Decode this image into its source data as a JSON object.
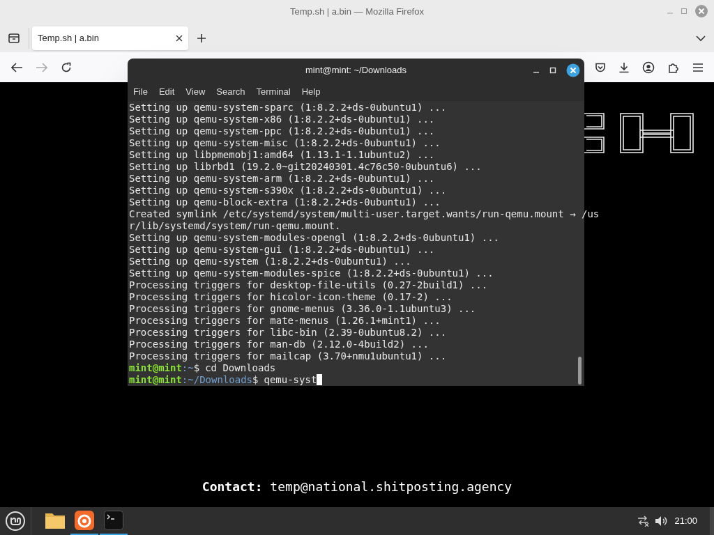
{
  "window": {
    "title": "Temp.sh | a.bin — Mozilla Firefox"
  },
  "tabs": [
    {
      "label": "Temp.sh | a.bin",
      "selected": true
    }
  ],
  "page": {
    "contact": "**Contact:** temp@national.shitposting.agency"
  },
  "terminal": {
    "title": "mint@mint: ~/Downloads",
    "menu": [
      "File",
      "Edit",
      "View",
      "Search",
      "Terminal",
      "Help"
    ],
    "lines": [
      {
        "kind": "output",
        "text": "Setting up qemu-system-sparc (1:8.2.2+ds-0ubuntu1) ..."
      },
      {
        "kind": "output",
        "text": "Setting up qemu-system-x86 (1:8.2.2+ds-0ubuntu1) ..."
      },
      {
        "kind": "output",
        "text": "Setting up qemu-system-ppc (1:8.2.2+ds-0ubuntu1) ..."
      },
      {
        "kind": "output",
        "text": "Setting up qemu-system-misc (1:8.2.2+ds-0ubuntu1) ..."
      },
      {
        "kind": "output",
        "text": "Setting up libpmemobj1:amd64 (1.13.1-1.1ubuntu2) ..."
      },
      {
        "kind": "output",
        "text": "Setting up librbd1 (19.2.0~git20240301.4c76c50-0ubuntu6) ..."
      },
      {
        "kind": "output",
        "text": "Setting up qemu-system-arm (1:8.2.2+ds-0ubuntu1) ..."
      },
      {
        "kind": "output",
        "text": "Setting up qemu-system-s390x (1:8.2.2+ds-0ubuntu1) ..."
      },
      {
        "kind": "output",
        "text": "Setting up qemu-block-extra (1:8.2.2+ds-0ubuntu1) ..."
      },
      {
        "kind": "output",
        "text": "Created symlink /etc/systemd/system/multi-user.target.wants/run-qemu.mount → /us"
      },
      {
        "kind": "output",
        "text": "r/lib/systemd/system/run-qemu.mount."
      },
      {
        "kind": "output",
        "text": "Setting up qemu-system-modules-opengl (1:8.2.2+ds-0ubuntu1) ..."
      },
      {
        "kind": "output",
        "text": "Setting up qemu-system-gui (1:8.2.2+ds-0ubuntu1) ..."
      },
      {
        "kind": "output",
        "text": "Setting up qemu-system (1:8.2.2+ds-0ubuntu1) ..."
      },
      {
        "kind": "output",
        "text": "Setting up qemu-system-modules-spice (1:8.2.2+ds-0ubuntu1) ..."
      },
      {
        "kind": "output",
        "text": "Processing triggers for desktop-file-utils (0.27-2build1) ..."
      },
      {
        "kind": "output",
        "text": "Processing triggers for hicolor-icon-theme (0.17-2) ..."
      },
      {
        "kind": "output",
        "text": "Processing triggers for gnome-menus (3.36.0-1.1ubuntu3) ..."
      },
      {
        "kind": "output",
        "text": "Processing triggers for mate-menus (1.26.1+mint1) ..."
      },
      {
        "kind": "output",
        "text": "Processing triggers for libc-bin (2.39-0ubuntu8.2) ..."
      },
      {
        "kind": "output",
        "text": "Processing triggers for man-db (2.12.0-4build2) ..."
      },
      {
        "kind": "output",
        "text": "Processing triggers for mailcap (3.70+nmu1ubuntu1) ..."
      },
      {
        "kind": "prompt",
        "user": "mint@mint",
        "path": ":~",
        "symbol": "$",
        "command": "cd Downloads",
        "cursor": false
      },
      {
        "kind": "prompt",
        "user": "mint@mint",
        "path": ":~/Downloads",
        "symbol": "$",
        "command": "qemu-syst",
        "cursor": true
      }
    ]
  },
  "taskbar": {
    "apps": [
      {
        "kind": "files",
        "active": false
      },
      {
        "kind": "browser",
        "active": true
      },
      {
        "kind": "terminal",
        "active": true
      }
    ],
    "clock": "21:00"
  }
}
